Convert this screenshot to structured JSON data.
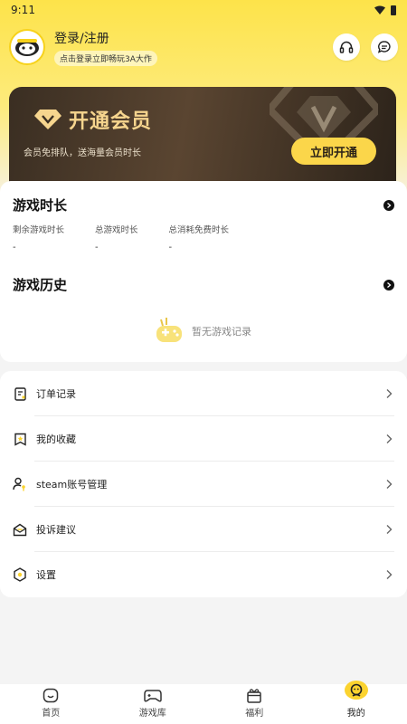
{
  "status_bar": {
    "time": "9:11"
  },
  "header": {
    "login_title": "登录/注册",
    "login_subtitle": "点击登录立即畅玩3A大作"
  },
  "vip": {
    "title": "开通会员",
    "description": "会员免排队，送海量会员时长",
    "button": "立即开通"
  },
  "game_time": {
    "title": "游戏时长",
    "stats": [
      {
        "label": "剩余游戏时长",
        "value": "-"
      },
      {
        "label": "总游戏时长",
        "value": "-"
      },
      {
        "label": "总消耗免费时长",
        "value": "-"
      }
    ]
  },
  "game_history": {
    "title": "游戏历史",
    "empty_text": "暂无游戏记录"
  },
  "menu": [
    {
      "label": "订单记录",
      "icon": "order-icon"
    },
    {
      "label": "我的收藏",
      "icon": "favorite-icon"
    },
    {
      "label": "steam账号管理",
      "icon": "account-key-icon"
    },
    {
      "label": "投诉建议",
      "icon": "feedback-mail-icon"
    },
    {
      "label": "设置",
      "icon": "settings-icon"
    }
  ],
  "tabs": [
    {
      "label": "首页",
      "icon": "home-icon"
    },
    {
      "label": "游戏库",
      "icon": "gamepad-icon"
    },
    {
      "label": "福利",
      "icon": "gift-icon"
    },
    {
      "label": "我的",
      "icon": "profile-icon",
      "active": true
    }
  ],
  "colors": {
    "accent": "#fbd32f",
    "vip_bg": "#3a2e22",
    "vip_gold": "#f6d58e"
  }
}
